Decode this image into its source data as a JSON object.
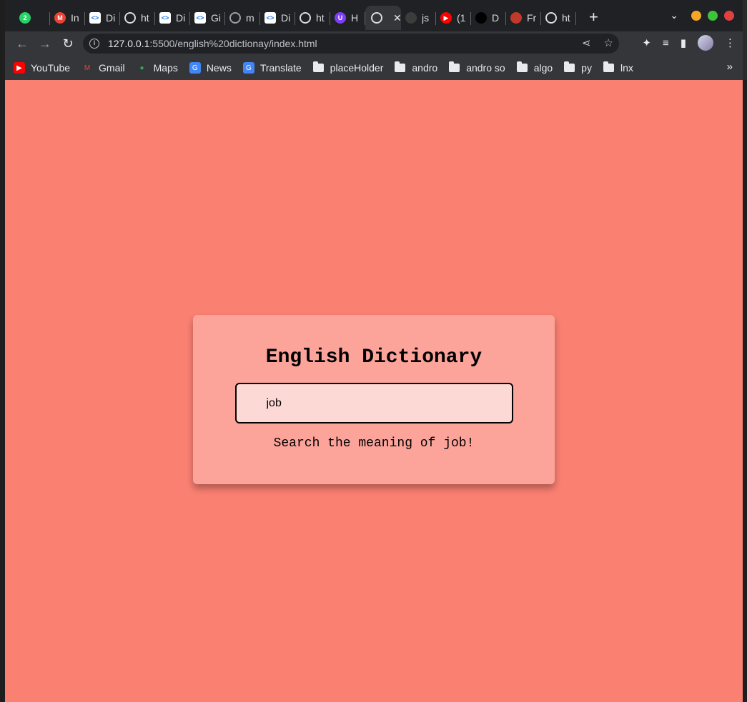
{
  "browser": {
    "tabs": [
      {
        "title": "",
        "icon": "whatsapp-icon",
        "color": "#25d366",
        "badge": "2"
      },
      {
        "title": "In",
        "icon": "gmail-icon",
        "color": "#ea4335",
        "badge": "M"
      },
      {
        "title": "Di",
        "icon": "devtools-icon",
        "color": "#ffffff",
        "badge": "<>"
      },
      {
        "title": "ht",
        "icon": "globe-icon",
        "color": "#dadce0",
        "badge": ""
      },
      {
        "title": "Di",
        "icon": "devtools-icon",
        "color": "#ffffff",
        "badge": "<>"
      },
      {
        "title": "Gi",
        "icon": "devtools-icon",
        "color": "#ffffff",
        "badge": "<>"
      },
      {
        "title": "m",
        "icon": "globe-icon",
        "color": "#9aa0a6",
        "badge": ""
      },
      {
        "title": "Di",
        "icon": "devtools-icon",
        "color": "#ffffff",
        "badge": "<>"
      },
      {
        "title": "ht",
        "icon": "globe-icon",
        "color": "#dadce0",
        "badge": ""
      },
      {
        "title": "H",
        "icon": "hub-icon",
        "color": "#7e3ff2",
        "badge": "U"
      },
      {
        "title": "",
        "icon": "globe-icon",
        "color": "#dadce0",
        "badge": "",
        "active": true
      },
      {
        "title": "js",
        "icon": "github-icon",
        "color": "#3c3c3c",
        "badge": ""
      },
      {
        "title": "(1",
        "icon": "youtube-icon",
        "color": "#ff0000",
        "badge": "▶"
      },
      {
        "title": "D",
        "icon": "square-icon",
        "color": "#000000",
        "badge": ""
      },
      {
        "title": "Fr",
        "icon": "book-icon",
        "color": "#c0392b",
        "badge": ""
      },
      {
        "title": "ht",
        "icon": "globe-icon",
        "color": "#dadce0",
        "badge": ""
      }
    ],
    "url_host": "127.0.0.1",
    "url_path": ":5500/english%20dictionay/index.html",
    "bookmarks": [
      {
        "label": "YouTube",
        "type": "site",
        "icon": "youtube-icon"
      },
      {
        "label": "Gmail",
        "type": "site",
        "icon": "gmail-icon"
      },
      {
        "label": "Maps",
        "type": "site",
        "icon": "maps-icon"
      },
      {
        "label": "News",
        "type": "site",
        "icon": "news-icon"
      },
      {
        "label": "Translate",
        "type": "site",
        "icon": "translate-icon"
      },
      {
        "label": "placeHolder",
        "type": "folder",
        "icon": "folder-icon"
      },
      {
        "label": "andro",
        "type": "folder",
        "icon": "folder-icon"
      },
      {
        "label": "andro so",
        "type": "folder",
        "icon": "folder-icon"
      },
      {
        "label": "algo",
        "type": "folder",
        "icon": "folder-icon"
      },
      {
        "label": "py",
        "type": "folder",
        "icon": "folder-icon"
      },
      {
        "label": "lnx",
        "type": "folder",
        "icon": "folder-icon"
      }
    ],
    "colors": {
      "bg": "#fa8072",
      "card": "#fca39a",
      "input": "#fdd9d6"
    }
  },
  "app": {
    "title": "English Dictionary",
    "input_value": "job",
    "info_text": "Search the meaning of job!"
  }
}
